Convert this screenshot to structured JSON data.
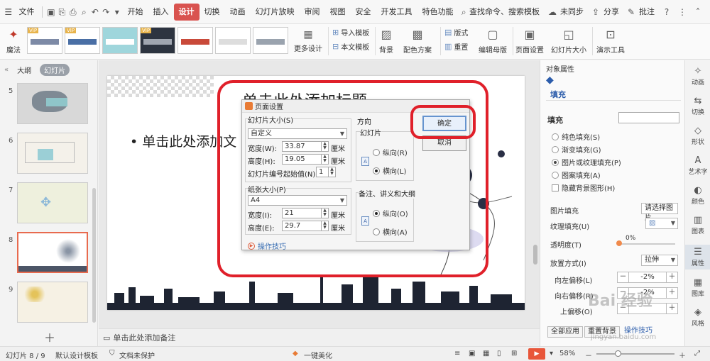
{
  "menu": {
    "file": "文件",
    "tabs": [
      "开始",
      "插入",
      "设计",
      "切换",
      "动画",
      "幻灯片放映",
      "审阅",
      "视图",
      "安全",
      "开发工具",
      "特色功能"
    ],
    "active_tab": "设计",
    "search": "查找命令、搜索模板",
    "sync": "未同步",
    "share": "分享",
    "comment": "批注"
  },
  "ribbon": {
    "magic": "魔法",
    "more_design": "更多设计",
    "import_template": "导入模板",
    "this_template": "本文模板",
    "background": "背景",
    "color_scheme": "配色方案",
    "layout": "版式",
    "reset": "重置",
    "edit_master": "编辑母版",
    "page_setup": "页面设置",
    "slide_size": "幻灯片大小",
    "presenter_tools": "演示工具",
    "vip": "VIP"
  },
  "left_panel": {
    "outline_tab": "大纲",
    "slides_tab": "幻灯片",
    "slide_numbers": [
      "5",
      "6",
      "7",
      "8",
      "9"
    ],
    "selected": "8"
  },
  "slide": {
    "title_partial": "单击此处添加标题",
    "bullet_text": "• 单击此处添加文"
  },
  "notes_placeholder": "单击此处添加备注",
  "dialog": {
    "title": "页面设置",
    "slide_size_group": "幻灯片大小(S)",
    "slide_size_value": "自定义",
    "width_label": "宽度(W):",
    "width_value": "33.87",
    "height_label": "高度(H):",
    "height_value": "19.05",
    "unit": "厘米",
    "start_num_label": "幻灯片编号起始值(N):",
    "start_num_value": "1",
    "paper_group": "纸张大小(P)",
    "paper_value": "A4",
    "paper_width_label": "宽度(I):",
    "paper_width_value": "21",
    "paper_height_label": "高度(E):",
    "paper_height_value": "29.7",
    "orientation_group": "方向",
    "slide_subgroup": "幻灯片",
    "portrait_r": "纵向(R)",
    "landscape_l": "横向(L)",
    "notes_subgroup": "备注、讲义和大纲",
    "portrait_o": "纵向(O)",
    "landscape_a": "横向(A)",
    "ok": "确定",
    "cancel": "取消",
    "tips": "操作技巧"
  },
  "right_panel": {
    "header": "对象属性",
    "tab": "填充",
    "section": "填充",
    "fill_options": [
      "纯色填充(S)",
      "渐变填充(G)",
      "图片或纹理填充(P)",
      "图案填充(A)"
    ],
    "selected_fill": 2,
    "hide_bg": "隐藏背景图形(H)",
    "picture_fill": "图片填充",
    "picture_fill_value": "请选择图片",
    "texture_fill": "纹理填充(U)",
    "transparency": "透明度(T)",
    "transparency_value": "0%",
    "placement": "放置方式(I)",
    "placement_value": "拉伸",
    "offset_left": "向左偏移(L)",
    "offset_left_value": "-2%",
    "offset_right": "向右偏移(R)",
    "offset_right_value": "-2%",
    "offset_up": "上偏移(O)",
    "apply_all": "全部应用",
    "reset_bg": "重置背景",
    "tips": "操作技巧"
  },
  "sidebar": [
    "动画",
    "切换",
    "形状",
    "艺术字",
    "颜色",
    "图表",
    "属性",
    "图库",
    "风格"
  ],
  "sidebar_active": "属性",
  "status": {
    "slide_pos": "幻灯片 8 / 9",
    "template": "默认设计模板",
    "protect": "文档未保护",
    "beautify": "一键美化",
    "zoom": "58%"
  },
  "watermark": "Bai 经验",
  "watermark_url": "jingyan.baidu.com",
  "colors": {
    "accent": "#d9534f",
    "annotation": "#e0202a",
    "link": "#2b5cab"
  }
}
